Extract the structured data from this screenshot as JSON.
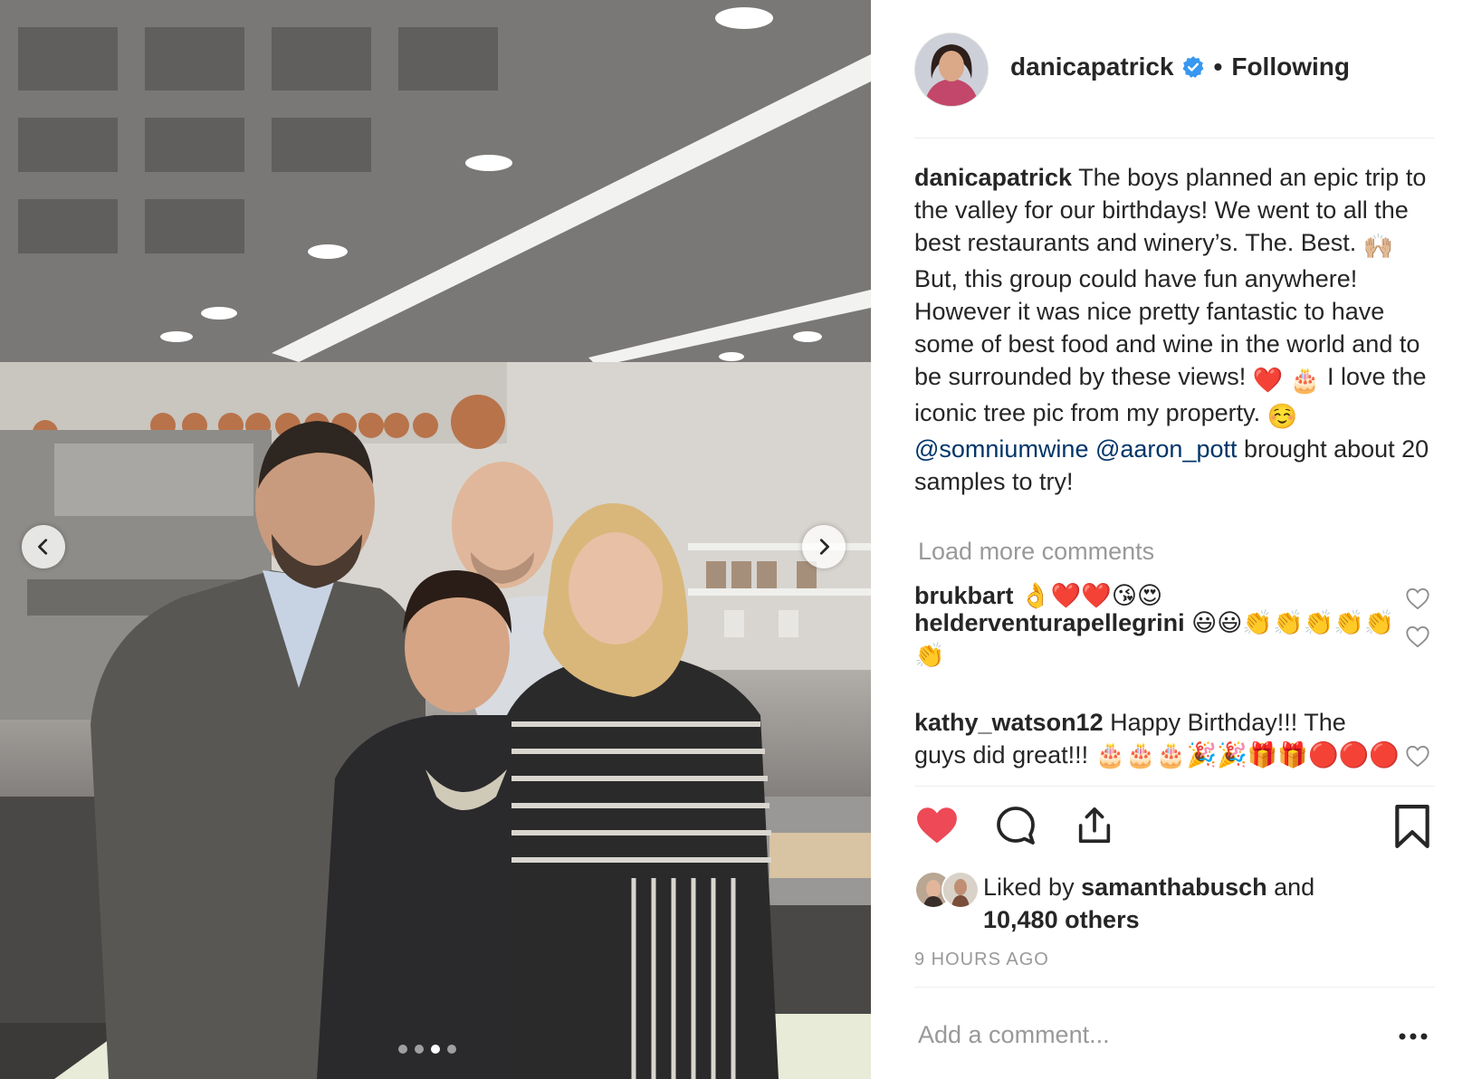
{
  "post": {
    "author": "danicapatrick",
    "follow_state": "Following",
    "separator": "•",
    "verified": true
  },
  "caption": {
    "username": "danicapatrick",
    "text_1": "The boys planned an epic trip to the valley for our birthdays! We went to all the best restaurants and winery’s. The. Best. ",
    "emoji_1": "🙌🏼",
    "text_2": " But, this group could have fun anywhere! However it was nice pretty fantastic to have some of best food and wine in the world and to be surrounded by these views! ",
    "emoji_2": "❤️ 🎂",
    "text_3": " I love the iconic tree pic from my property. ",
    "emoji_3": "☺️",
    "mention_1": "@somniumwine",
    "mention_2": "@aaron_pott",
    "text_4": " brought about 20 samples to try!"
  },
  "comments": {
    "load_more": "Load more comments",
    "items": [
      {
        "username": "brukbart",
        "text": "👌❤️❤️😘😍"
      },
      {
        "username": "helderventurapellegrini",
        "text": "😃😃👏👏👏👏👏👏"
      },
      {
        "username": "kathy_watson12",
        "text": "Happy Birthday!!! The guys did great!!! 🎂🎂🎂🎉🎉🎁🎁🔴🔴🔴"
      }
    ]
  },
  "likes": {
    "prefix": "Liked by ",
    "user": "samanthabusch",
    "middle": " and",
    "count": "10,480 others"
  },
  "timestamp": "9 HOURS AGO",
  "add_comment": {
    "placeholder": "Add a comment..."
  },
  "carousel": {
    "total": 4,
    "active_index": 2
  },
  "colors": {
    "like_red": "#ed4956",
    "mention_blue": "#003569",
    "verified_blue": "#3897f0",
    "muted_text": "#999999"
  },
  "icons": {
    "prev": "chevron-left-icon",
    "next": "chevron-right-icon",
    "like": "heart-filled-icon",
    "comment": "speech-bubble-icon",
    "share": "share-upload-icon",
    "save": "bookmark-icon",
    "more": "more-horizontal-icon",
    "verified": "verified-badge-icon"
  }
}
